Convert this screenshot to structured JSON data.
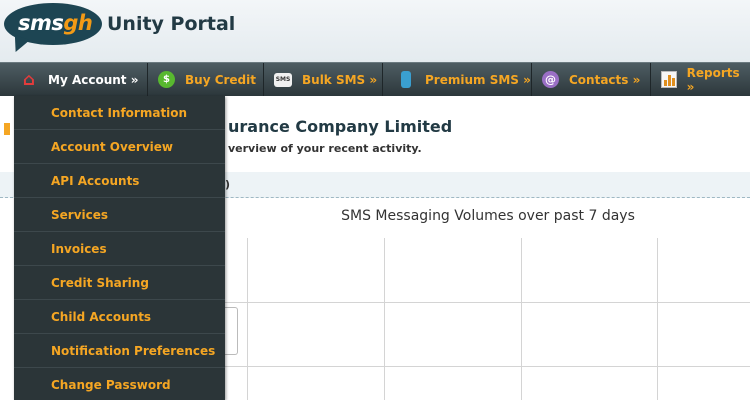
{
  "brand": {
    "logo_sms": "sms",
    "logo_gh": "gh",
    "title": "Unity Portal"
  },
  "nav": {
    "items": [
      {
        "label": "My Account »",
        "icon": "home-icon"
      },
      {
        "label": "Buy Credit",
        "icon": "dollar-icon"
      },
      {
        "label": "Bulk SMS »",
        "icon": "sms-icon"
      },
      {
        "label": "Premium SMS »",
        "icon": "phone-icon"
      },
      {
        "label": "Contacts »",
        "icon": "at-icon"
      },
      {
        "label": "Reports »",
        "icon": "chart-icon"
      }
    ],
    "sms_icon_text": "SMS",
    "dollar_icon_text": "$",
    "at_icon_text": "@"
  },
  "dropdown": {
    "items": [
      "Contact Information",
      "Account Overview",
      "API Accounts",
      "Services",
      "Invoices",
      "Credit Sharing",
      "Child Accounts",
      "Notification Preferences",
      "Change Password"
    ]
  },
  "main": {
    "company": "urance Company Limited",
    "subtitle": "verview of your recent activity.",
    "strip_text": ")",
    "chart_title": "SMS Messaging Volumes over past 7 days"
  },
  "colors": {
    "accent": "#f5a623",
    "nav_dark": "#2b3538",
    "brand_dark": "#1d4553"
  }
}
